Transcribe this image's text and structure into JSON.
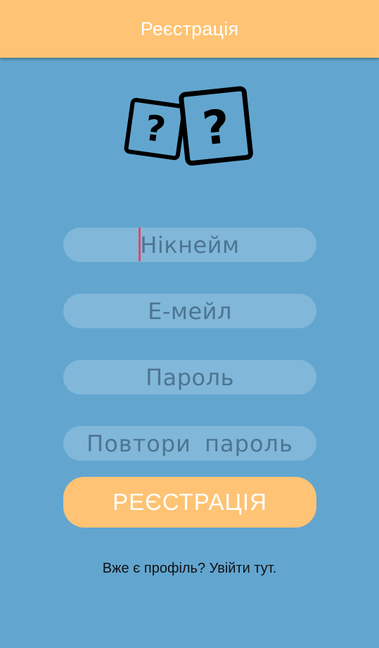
{
  "app_bar": {
    "title": "Реєстрація"
  },
  "logo": {
    "icon": "question-dice-icon",
    "glyph": "?"
  },
  "form": {
    "nickname": {
      "placeholder": "Нікнейм",
      "value": ""
    },
    "email": {
      "placeholder": "Е-мейл",
      "value": ""
    },
    "password": {
      "placeholder": "Пароль",
      "value": ""
    },
    "repeat_password": {
      "placeholder": "Повтори пароль",
      "value": ""
    },
    "submit_label": "РЕЄСТРАЦІЯ"
  },
  "login_link": {
    "text": "Вже є профіль? Увійти тут."
  },
  "colors": {
    "background": "#62a6d0",
    "accent": "#fec374",
    "placeholder": "#4d7591",
    "caret": "#e0466f"
  }
}
